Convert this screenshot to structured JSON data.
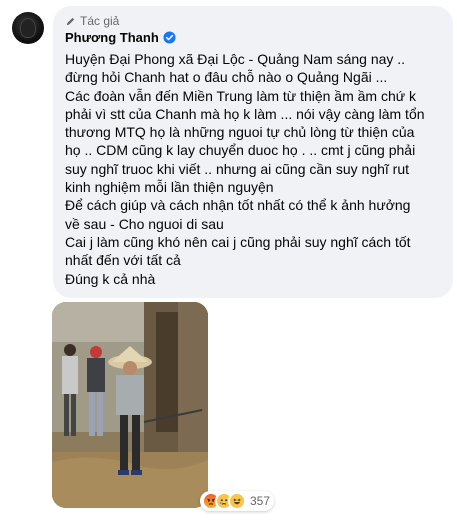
{
  "comment": {
    "author_badge": "Tác giả",
    "author_name": "Phương Thanh",
    "verified_icon": "verified-badge-icon",
    "lines": [
      "Huyện Đại Phong xã Đại Lộc - Quảng Nam sáng nay ..",
      "đừng hỏi Chanh hat o đâu chỗ nào o Quảng Ngãi ...",
      "Các đoàn vẫn đến Miền Trung làm từ thiện ầm ầm chứ k",
      "phải vì stt của Chanh mà họ k làm ... nói vậy càng làm tổn",
      "thương MTQ họ là những nguoi tự chủ lòng từ thiện của",
      "họ .. CDM cũng k lay chuyển duoc họ . .. cmt j cũng phải",
      "suy nghĩ truoc khi viết .. nhưng ai cũng cần suy nghĩ rut",
      "kinh nghiệm mỗi lần thiện nguyện",
      "Để cách giúp và cách nhận tốt nhất có thể k ảnh hưởng",
      "về sau - Cho nguoi di sau",
      "Cai j làm cũng khó nên cai j cũng phải suy nghĩ cách tốt",
      "nhất đến với tất cả",
      "Đúng k cả nhà"
    ]
  },
  "reactions": {
    "icons": [
      "angry-reaction-icon",
      "sad-reaction-icon",
      "haha-reaction-icon"
    ],
    "count": "357"
  },
  "colors": {
    "bubble_bg": "#f0f2f5",
    "verified_blue": "#1877f2",
    "secondary_text": "#65676b"
  }
}
